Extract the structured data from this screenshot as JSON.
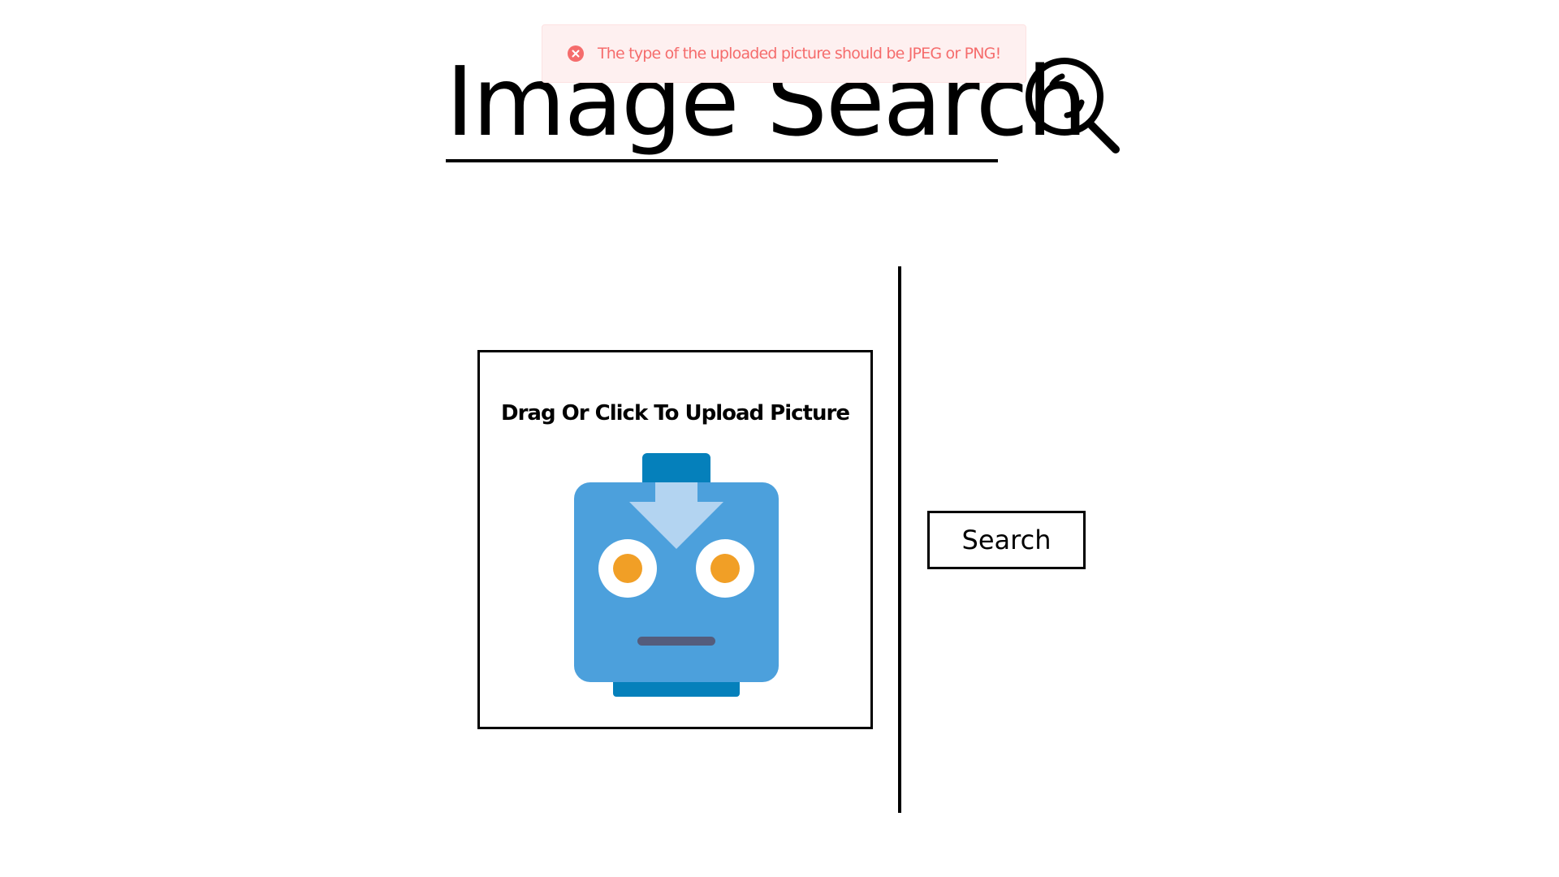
{
  "header": {
    "title": "Image Search",
    "icon": "magnifier-icon"
  },
  "toast": {
    "type": "error",
    "icon": "error-circle-icon",
    "message": "The type of the uploaded picture should be JPEG or PNG!",
    "color": "#f56c6c",
    "background": "#fef0f0"
  },
  "upload": {
    "label": "Drag Or Click To Upload Picture",
    "icon": "robot-upload-icon",
    "colors": {
      "face": "#4ca0dc",
      "accent": "#0580bb",
      "arrow": "#b3d4f1",
      "eye_iris": "#f19f26",
      "mouth": "#545c7c"
    }
  },
  "actions": {
    "search_label": "Search"
  }
}
